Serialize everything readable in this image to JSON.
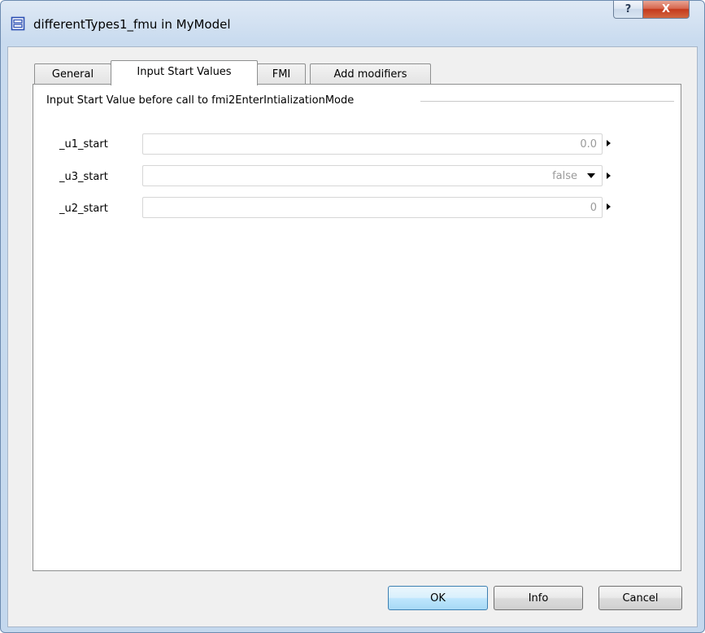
{
  "window": {
    "title": "differentTypes1_fmu in MyModel",
    "help_glyph": "?",
    "close_glyph": "X"
  },
  "tabs": [
    {
      "label": "General",
      "active": false
    },
    {
      "label": "Input Start Values",
      "active": true
    },
    {
      "label": "FMI",
      "active": false
    },
    {
      "label": "Add modifiers",
      "active": false
    }
  ],
  "group": {
    "title": "Input Start Value before call to fmi2EnterIntializationMode"
  },
  "params": [
    {
      "label": "_u1_start",
      "value": "0.0",
      "type": "text"
    },
    {
      "label": "_u3_start",
      "value": "false",
      "type": "dropdown"
    },
    {
      "label": "_u2_start",
      "value": "0",
      "type": "text"
    }
  ],
  "buttons": {
    "ok": "OK",
    "info": "Info",
    "cancel": "Cancel"
  },
  "icons": {
    "window_icon": "component-icon",
    "context_arrow": "triangle-right",
    "dropdown": "triangle-down"
  },
  "colors": {
    "titlebar": "#c4d8ee",
    "close_button": "#c4391c",
    "default_button": "#bee6fd"
  }
}
